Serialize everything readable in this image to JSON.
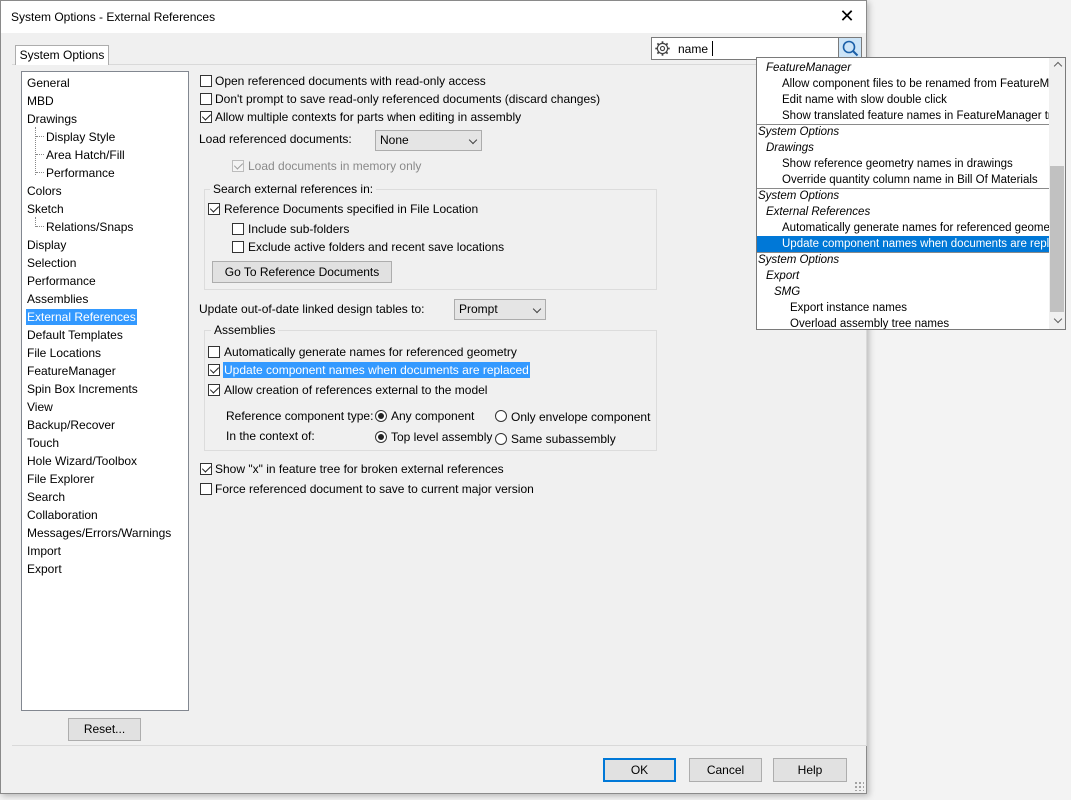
{
  "window": {
    "title": "System Options - External References",
    "close_glyph": "✕"
  },
  "tab": {
    "label": "System Options"
  },
  "tree": {
    "items": [
      {
        "label": "General"
      },
      {
        "label": "MBD"
      },
      {
        "label": "Drawings"
      },
      {
        "label": "Display Style"
      },
      {
        "label": "Area Hatch/Fill"
      },
      {
        "label": "Performance"
      },
      {
        "label": "Colors"
      },
      {
        "label": "Sketch"
      },
      {
        "label": "Relations/Snaps"
      },
      {
        "label": "Display"
      },
      {
        "label": "Selection"
      },
      {
        "label": "Performance"
      },
      {
        "label": "Assemblies"
      },
      {
        "label": "External References"
      },
      {
        "label": "Default Templates"
      },
      {
        "label": "File Locations"
      },
      {
        "label": "FeatureManager"
      },
      {
        "label": "Spin Box Increments"
      },
      {
        "label": "View"
      },
      {
        "label": "Backup/Recover"
      },
      {
        "label": "Touch"
      },
      {
        "label": "Hole Wizard/Toolbox"
      },
      {
        "label": "File Explorer"
      },
      {
        "label": "Search"
      },
      {
        "label": "Collaboration"
      },
      {
        "label": "Messages/Errors/Warnings"
      },
      {
        "label": "Import"
      },
      {
        "label": "Export"
      }
    ],
    "selected": "External References"
  },
  "options": {
    "open_readonly": "Open referenced documents with read-only access",
    "dont_prompt": "Don't prompt to save read-only referenced documents (discard changes)",
    "allow_multiple": "Allow multiple contexts for parts when editing in assembly",
    "load_label": "Load referenced documents:",
    "load_value": "None",
    "load_memory": "Load documents in memory only",
    "search_group": "Search external references in:",
    "ref_docs": "Reference Documents specified in File Location",
    "include_sub": "Include sub-folders",
    "exclude_active": "Exclude active folders and recent save locations",
    "goto_button": "Go To Reference Documents",
    "update_label": "Update out-of-date linked design tables to:",
    "update_value": "Prompt",
    "assemblies_group": "Assemblies",
    "auto_gen": "Automatically generate names for referenced geometry",
    "update_names": "Update component names when documents are replaced",
    "allow_creation": "Allow creation of references external to the model",
    "ref_type_label": "Reference component type:",
    "any_component": "Any component",
    "only_envelope": "Only envelope component",
    "context_label": "In the context of:",
    "top_level": "Top level assembly",
    "same_sub": "Same subassembly",
    "show_x": "Show \"x\" in feature tree for broken external references",
    "force_save": "Force referenced document to save to current major version"
  },
  "search": {
    "value": "name",
    "icon_left": "gear-icon",
    "icon_right": "search-icon"
  },
  "dropdown": {
    "rows": [
      "FeatureManager",
      "Allow component files to be renamed from FeatureManager",
      "Edit name with slow double click",
      "Show translated feature names in FeatureManager tree",
      "System Options",
      "Drawings",
      "Show reference geometry names in drawings",
      "Override quantity column name in Bill Of Materials",
      "System Options",
      "External References",
      "Automatically generate names for referenced geometry",
      "Update component names when documents are replaced",
      "System Options",
      "Export",
      "SMG",
      "Export instance names",
      "Overload assembly tree names"
    ]
  },
  "buttons": {
    "reset": "Reset...",
    "ok": "OK",
    "cancel": "Cancel",
    "help": "Help"
  },
  "colors": {
    "selection": "#3399ff",
    "dropdown_selection": "#0078d7",
    "default_button_border": "#0078d7"
  }
}
